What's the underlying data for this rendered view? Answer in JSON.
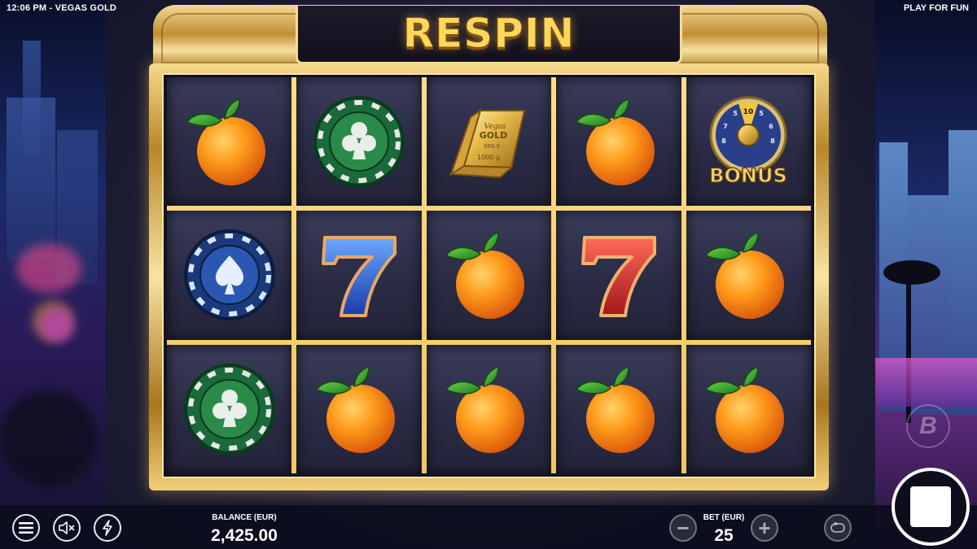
{
  "status_bar": {
    "time_title": "12:06 PM - VEGAS GOLD",
    "mode": "PLAY FOR FUN"
  },
  "banner": {
    "text": "RESPIN"
  },
  "reels": [
    [
      "orange",
      "club-chip",
      "gold-bar",
      "orange",
      "bonus-wheel"
    ],
    [
      "spade-chip",
      "blue-seven",
      "orange",
      "red-seven",
      "orange"
    ],
    [
      "club-chip",
      "orange",
      "orange",
      "orange",
      "orange"
    ]
  ],
  "symbols": {
    "gold_bar": {
      "line1": "Vegas",
      "line2": "GOLD",
      "line3": "999.9",
      "line4": "1000 g"
    },
    "bonus_wheel": {
      "label": "BONUS",
      "numbers": [
        "5",
        "10",
        "5",
        "6",
        "8",
        "8",
        "7"
      ]
    }
  },
  "footer": {
    "balance_label": "BALANCE (EUR)",
    "balance_value": "2,425.00",
    "bet_label": "BET (EUR)",
    "bet_value": "25",
    "minus": "−",
    "plus": "+",
    "logo_letter": "B"
  },
  "colors": {
    "gold": "#f6d98a",
    "banner_text": "#ffd75a",
    "cell_bg": "#2a2b44"
  }
}
